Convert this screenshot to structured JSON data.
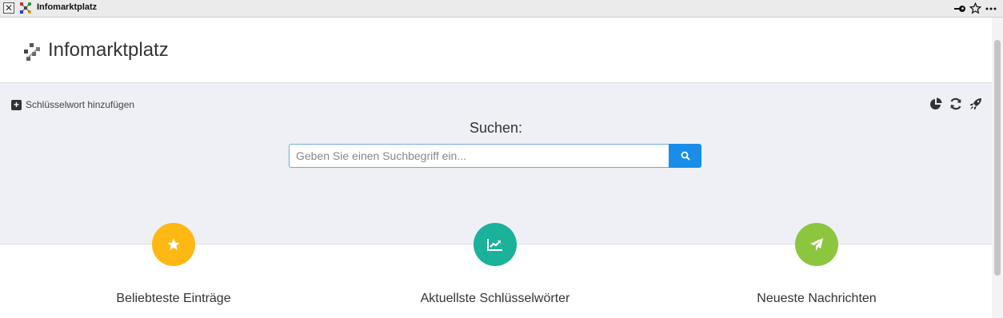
{
  "window": {
    "title": "Infomarktplatz",
    "close_glyph": "✕",
    "icons": [
      "key-icon",
      "star-icon",
      "more-icon"
    ]
  },
  "header": {
    "brand": "Infomarktplatz",
    "logo_icon": "marketplace-logo-icon"
  },
  "toolbar": {
    "add_keyword": "Schlüsselwort hinzufügen",
    "tools": [
      "pie-chart-icon",
      "refresh-icon",
      "rocket-icon"
    ]
  },
  "search": {
    "title": "Suchen:",
    "placeholder": "Geben Sie einen Suchbegriff ein...",
    "button_icon": "search-icon"
  },
  "features": [
    {
      "label": "Beliebteste Einträge",
      "icon": "star-icon",
      "color": "#fdb813"
    },
    {
      "label": "Aktuellste Schlüsselwörter",
      "icon": "trend-chart-icon",
      "color": "#1ab29b"
    },
    {
      "label": "Neueste Nachrichten",
      "icon": "paper-plane-icon",
      "color": "#8cc63f"
    }
  ],
  "colors": {
    "accent": "#1a8de8",
    "band_background": "#eef0f5"
  }
}
